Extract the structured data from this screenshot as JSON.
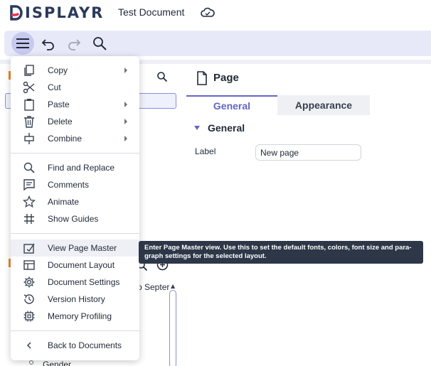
{
  "app": {
    "logo_text": "ISPLAYR",
    "document_title": "Test Document",
    "colors": {
      "brand_red": "#e8344e",
      "accent": "#6366c7",
      "toolbar_bg": "#e8e9f8",
      "tooltip_bg": "#2d3748"
    }
  },
  "toolbar": {
    "items": [
      {
        "icon": "hamburger-menu-icon",
        "active": true
      },
      {
        "icon": "undo-icon",
        "active": false
      },
      {
        "icon": "redo-icon",
        "active": false,
        "disabled": true
      },
      {
        "icon": "search-icon",
        "active": false
      }
    ]
  },
  "background": {
    "truncated_text": "o Septer",
    "bottom_item": "Gender"
  },
  "properties": {
    "title": "Page",
    "tabs": [
      {
        "label": "General",
        "active": true
      },
      {
        "label": "Appearance",
        "active": false
      }
    ],
    "section_title": "General",
    "fields": [
      {
        "label": "Label",
        "value": "New page"
      }
    ]
  },
  "menu": {
    "groups": [
      [
        {
          "label": "Copy",
          "icon": "copy-icon",
          "submenu": true
        },
        {
          "label": "Cut",
          "icon": "scissors-icon",
          "submenu": false
        },
        {
          "label": "Paste",
          "icon": "clipboard-icon",
          "submenu": true
        },
        {
          "label": "Delete",
          "icon": "trash-icon",
          "submenu": true
        },
        {
          "label": "Combine",
          "icon": "combine-icon",
          "submenu": true
        }
      ],
      [
        {
          "label": "Find and Replace",
          "icon": "search-icon",
          "submenu": false
        },
        {
          "label": "Comments",
          "icon": "comment-icon",
          "submenu": false
        },
        {
          "label": "Animate",
          "icon": "star-icon",
          "submenu": false
        },
        {
          "label": "Show Guides",
          "icon": "grid-hash-icon",
          "submenu": false
        }
      ],
      [
        {
          "label": "View Page Master",
          "icon": "page-master-icon",
          "submenu": false,
          "hovered": true
        },
        {
          "label": "Document Layout",
          "icon": "layout-icon",
          "submenu": false
        },
        {
          "label": "Document Settings",
          "icon": "gear-icon",
          "submenu": false
        },
        {
          "label": "Version History",
          "icon": "history-icon",
          "submenu": false
        },
        {
          "label": "Memory Profiling",
          "icon": "chip-icon",
          "submenu": false
        }
      ],
      [
        {
          "label": "Back to Documents",
          "icon": "chevron-left-icon",
          "submenu": false
        }
      ]
    ]
  },
  "tooltip": {
    "line1": "Enter Page Master view. Use this to set the default fonts, colors, font size and para-",
    "line2": "graph settings for the selected layout."
  }
}
